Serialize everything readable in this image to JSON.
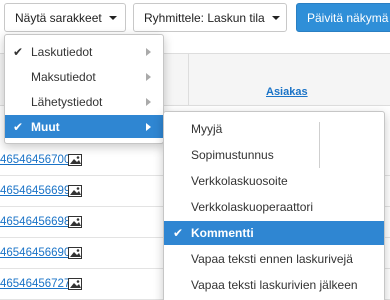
{
  "toolbar": {
    "columns_button": "Näytä sarakkeet",
    "group_button": "Ryhmittele: Laskun tila",
    "refresh_button": "Päivitä näkymä"
  },
  "table": {
    "header_link": "Asiakas",
    "rows": [
      "46546456700",
      "46546456699",
      "46546456698",
      "46546456690",
      "46546456727"
    ]
  },
  "menu": {
    "items": [
      {
        "label": "Laskutiedot",
        "checked": true,
        "submenu": true
      },
      {
        "label": "Maksutiedot",
        "checked": false,
        "submenu": true
      },
      {
        "label": "Lähetystiedot",
        "checked": false,
        "submenu": true
      },
      {
        "label": "Muut",
        "checked": true,
        "submenu": true,
        "active": true
      }
    ]
  },
  "submenu": {
    "items": [
      {
        "label": "Myyjä",
        "checked": false
      },
      {
        "label": "Sopimustunnus",
        "checked": false
      },
      {
        "label": "Verkkolaskuosoite",
        "checked": false
      },
      {
        "label": "Verkkolaskuoperaattori",
        "checked": false
      },
      {
        "label": "Kommentti",
        "checked": true,
        "active": true
      },
      {
        "label": "Vapaa teksti ennen laskurivejä",
        "checked": false
      },
      {
        "label": "Vapaa teksti laskurivien jälkeen",
        "checked": false
      }
    ]
  },
  "colors": {
    "accent": "#2f86d2",
    "link": "#1a73c7"
  },
  "icons": {
    "check": "✔",
    "image": "image-icon"
  }
}
